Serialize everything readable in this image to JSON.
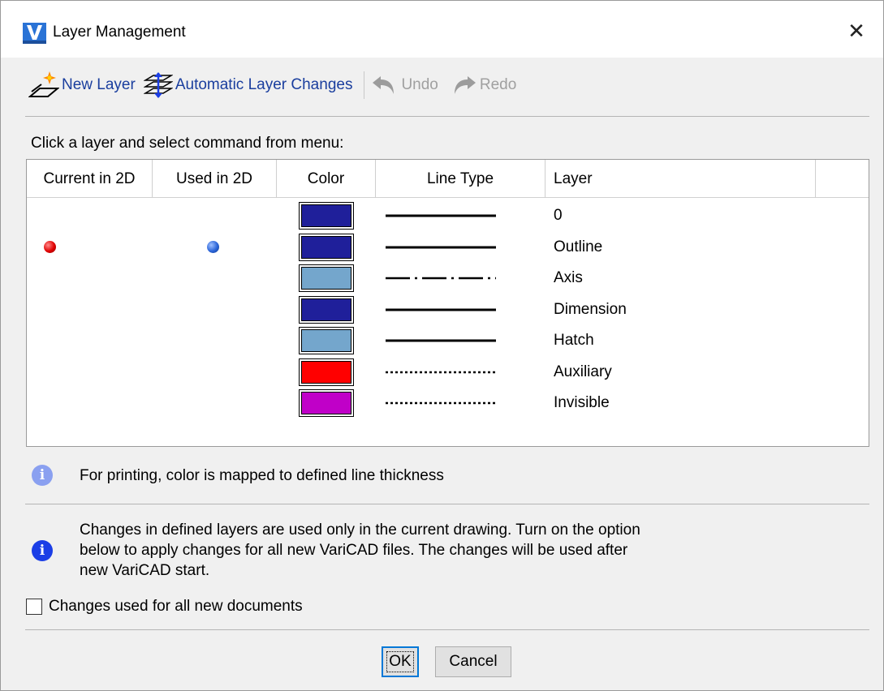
{
  "window": {
    "title": "Layer Management",
    "app_icon_letter": "V",
    "close_glyph": "✕"
  },
  "toolbar": {
    "new_layer": "New Layer",
    "auto_changes": "Automatic Layer Changes",
    "undo": "Undo",
    "redo": "Redo"
  },
  "hint": "Click a layer and select command from menu:",
  "table": {
    "headers": [
      "Current in 2D",
      "Used in 2D",
      "Color",
      "Line Type",
      "Layer"
    ],
    "rows": [
      {
        "name": "0",
        "color": "#1f1f9a",
        "linetype": "solid",
        "current": false,
        "used": false
      },
      {
        "name": "Outline",
        "color": "#1f1f9a",
        "linetype": "solid",
        "current": true,
        "used": true
      },
      {
        "name": "Axis",
        "color": "#74a6cc",
        "linetype": "dash-dot",
        "current": false,
        "used": false
      },
      {
        "name": "Dimension",
        "color": "#1f1f9a",
        "linetype": "solid",
        "current": false,
        "used": false
      },
      {
        "name": "Hatch",
        "color": "#74a6cc",
        "linetype": "solid",
        "current": false,
        "used": false
      },
      {
        "name": "Auxiliary",
        "color": "#ff0000",
        "linetype": "dotted",
        "current": false,
        "used": false
      },
      {
        "name": "Invisible",
        "color": "#c000c8",
        "linetype": "dotted",
        "current": false,
        "used": false
      }
    ]
  },
  "info": {
    "print_note": "For printing, color is mapped to defined line thickness",
    "changes_note_1": "Changes in defined layers are used only in the current drawing. Turn on the option",
    "changes_note_2": "below to apply changes for all new VariCAD files. The changes will be used after",
    "changes_note_3": "new VariCAD start."
  },
  "option": {
    "label": "Changes used for all new documents",
    "checked": false
  },
  "buttons": {
    "ok": "OK",
    "cancel": "Cancel"
  },
  "colors": {
    "link_blue": "#1a3e9e",
    "focus_blue": "#0078d7",
    "info_light": "#8aa0f0",
    "info_dark": "#1b3ee6"
  }
}
